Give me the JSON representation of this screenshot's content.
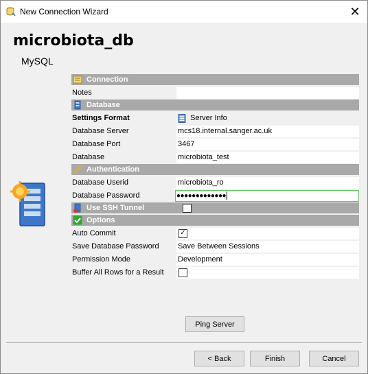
{
  "window": {
    "title": "New Connection Wizard"
  },
  "header": {
    "name": "microbiota_db",
    "type": "MySQL"
  },
  "sections": {
    "connection": "Connection",
    "database": "Database",
    "authentication": "Authentication",
    "ssh": "Use SSH Tunnel",
    "options": "Options"
  },
  "fields": {
    "notes_label": "Notes",
    "notes_value": "",
    "settings_format_label": "Settings Format",
    "settings_format_value": "Server Info",
    "server_label": "Database Server",
    "server_value": "mcs18.internal.sanger.ac.uk",
    "port_label": "Database Port",
    "port_value": "3467",
    "database_label": "Database",
    "database_value": "microbiota_test",
    "userid_label": "Database Userid",
    "userid_value": "microbiota_ro",
    "password_label": "Database Password",
    "password_value": "●●●●●●●●●●●●●",
    "ssh_checked": false,
    "autocommit_label": "Auto Commit",
    "autocommit_checked": true,
    "save_pwd_label": "Save Database Password",
    "save_pwd_value": "Save Between Sessions",
    "permission_label": "Permission Mode",
    "permission_value": "Development",
    "buffer_label": "Buffer All Rows for a Result",
    "buffer_checked": false
  },
  "buttons": {
    "ping": "Ping Server",
    "back": "< Back",
    "finish": "Finish",
    "cancel": "Cancel"
  },
  "icons": {
    "app": "database-connection-icon",
    "close": "close-icon",
    "connection": "notes-icon",
    "database": "database-icon",
    "authentication": "key-icon",
    "ssh": "ssh-tunnel-icon",
    "options": "checkmark-icon",
    "server_info": "server-info-icon",
    "illustration": "database-server-icon"
  },
  "colors": {
    "section_header_bg": "#a9a9a9",
    "focus_border": "#63c463",
    "options_check": "#2fa82f"
  }
}
